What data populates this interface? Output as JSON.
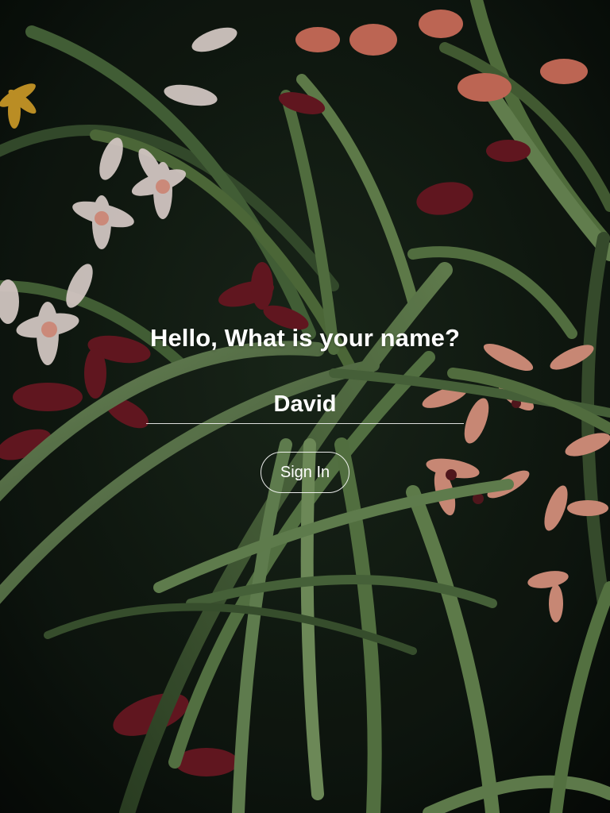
{
  "background": {
    "description_icon": "orchid-foliage-photo-background",
    "leaf_color": "#5f7f4e",
    "dark_color": "#0c130d",
    "flower_pink": "#e39a85",
    "flower_white": "#efe3df",
    "flower_dark_red": "#6e1a24",
    "flower_yellow": "#d4a12a"
  },
  "login": {
    "prompt": "Hello, What is your name?",
    "name_value": "David",
    "sign_in_label": "Sign In"
  }
}
